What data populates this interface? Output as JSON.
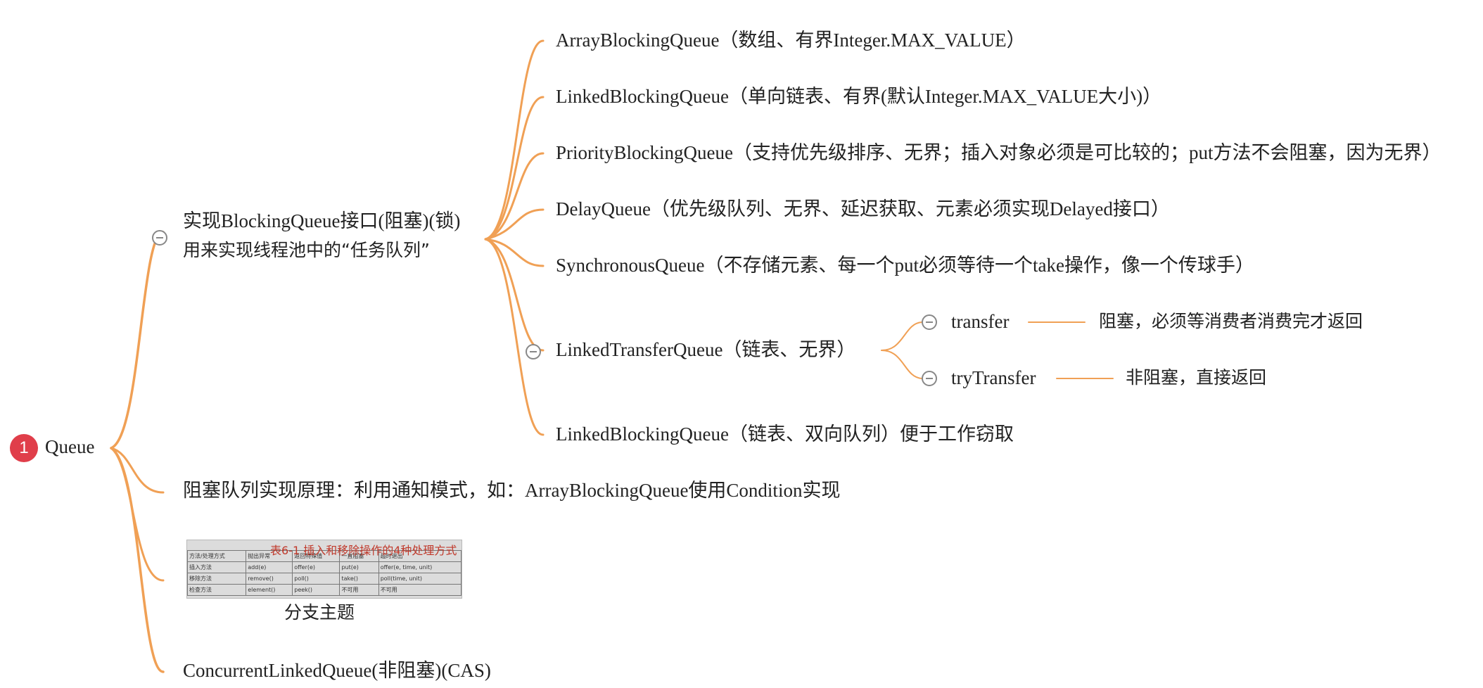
{
  "root": {
    "badge": "1",
    "label": "Queue"
  },
  "blocking": {
    "line1": "实现BlockingQueue接口(阻塞)(锁)",
    "line2": "用来实现线程池中的“任务队列”",
    "children": [
      "ArrayBlockingQueue（数组、有界Integer.MAX_VALUE）",
      "LinkedBlockingQueue（单向链表、有界(默认Integer.MAX_VALUE大小)）",
      "PriorityBlockingQueue（支持优先级排序、无界；插入对象必须是可比较的；put方法不会阻塞，因为无界）",
      "DelayQueue（优先级队列、无界、延迟获取、元素必须实现Delayed接口）",
      "SynchronousQueue（不存储元素、每一个put必须等待一个take操作，像一个传球手）",
      "LinkedTransferQueue（链表、无界）",
      "LinkedBlockingQueue（链表、双向队列）便于工作窃取"
    ],
    "transfer": {
      "label": "transfer",
      "note": "阻塞，必须等消费者消费完才返回"
    },
    "try_transfer": {
      "label": "tryTransfer",
      "note": "非阻塞，直接返回"
    }
  },
  "principle": "阻塞队列实现原理：利用通知模式，如：ArrayBlockingQueue使用Condition实现",
  "image_topic": {
    "caption": "分支主题",
    "table_title": "表6-1  插入和移除操作的4种处理方式",
    "table_rows": [
      [
        "方法/处理方式",
        "抛出异常",
        "返回特殊值",
        "一直阻塞",
        "超时退出"
      ],
      [
        "插入方法",
        "add(e)",
        "offer(e)",
        "put(e)",
        "offer(e, time, unit)"
      ],
      [
        "移除方法",
        "remove()",
        "poll()",
        "take()",
        "poll(time, unit)"
      ],
      [
        "检查方法",
        "element()",
        "peek()",
        "不可用",
        "不可用"
      ]
    ]
  },
  "concurrent": "ConcurrentLinkedQueue(非阻塞)(CAS)",
  "colors": {
    "branch": "#f0a055",
    "badge": "#e03e4a",
    "collapse": "#888888"
  }
}
